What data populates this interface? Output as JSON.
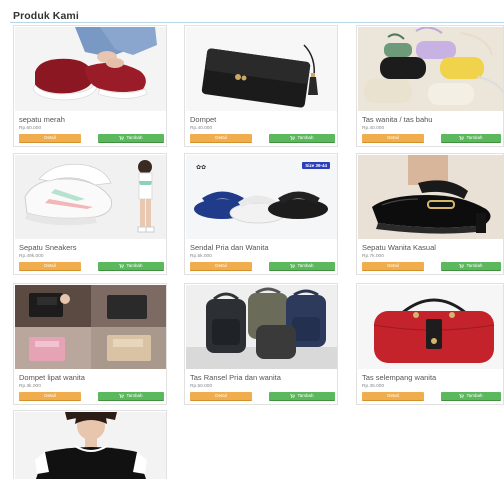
{
  "section": {
    "title": "Produk Kami"
  },
  "buttons": {
    "detail": "Detail",
    "add": "Tambah"
  },
  "products": [
    {
      "name": "sepatu merah",
      "price": "Rp.60.000"
    },
    {
      "name": "Dompet",
      "price": "Rp.40.000"
    },
    {
      "name": "Tas wanita / tas bahu",
      "price": "Rp.40.000"
    },
    {
      "name": "Sepatu Sneakers",
      "price": "Rp.49k.000"
    },
    {
      "name": "Sendal Pria dan Wanita",
      "price": "Rp.5k.000"
    },
    {
      "name": "Sepatu Wanita Kasual",
      "price": "Rp.7k.000"
    },
    {
      "name": "Dompet lipat wanita",
      "price": "Rp.3k.000"
    },
    {
      "name": "Tas Ransel Pria dan wanita",
      "price": "Rp.50.000"
    },
    {
      "name": "Tas selempang wanita",
      "price": "Rp.35.000"
    },
    {
      "name": "",
      "price": ""
    }
  ],
  "badges": {
    "size": "Size 39-44"
  },
  "colors": {
    "detail_button": "#f0ad4e",
    "add_button": "#5cb85c",
    "title_rule": "#b8d6e6"
  },
  "icons": {
    "add_button_icon": "cart-icon"
  }
}
